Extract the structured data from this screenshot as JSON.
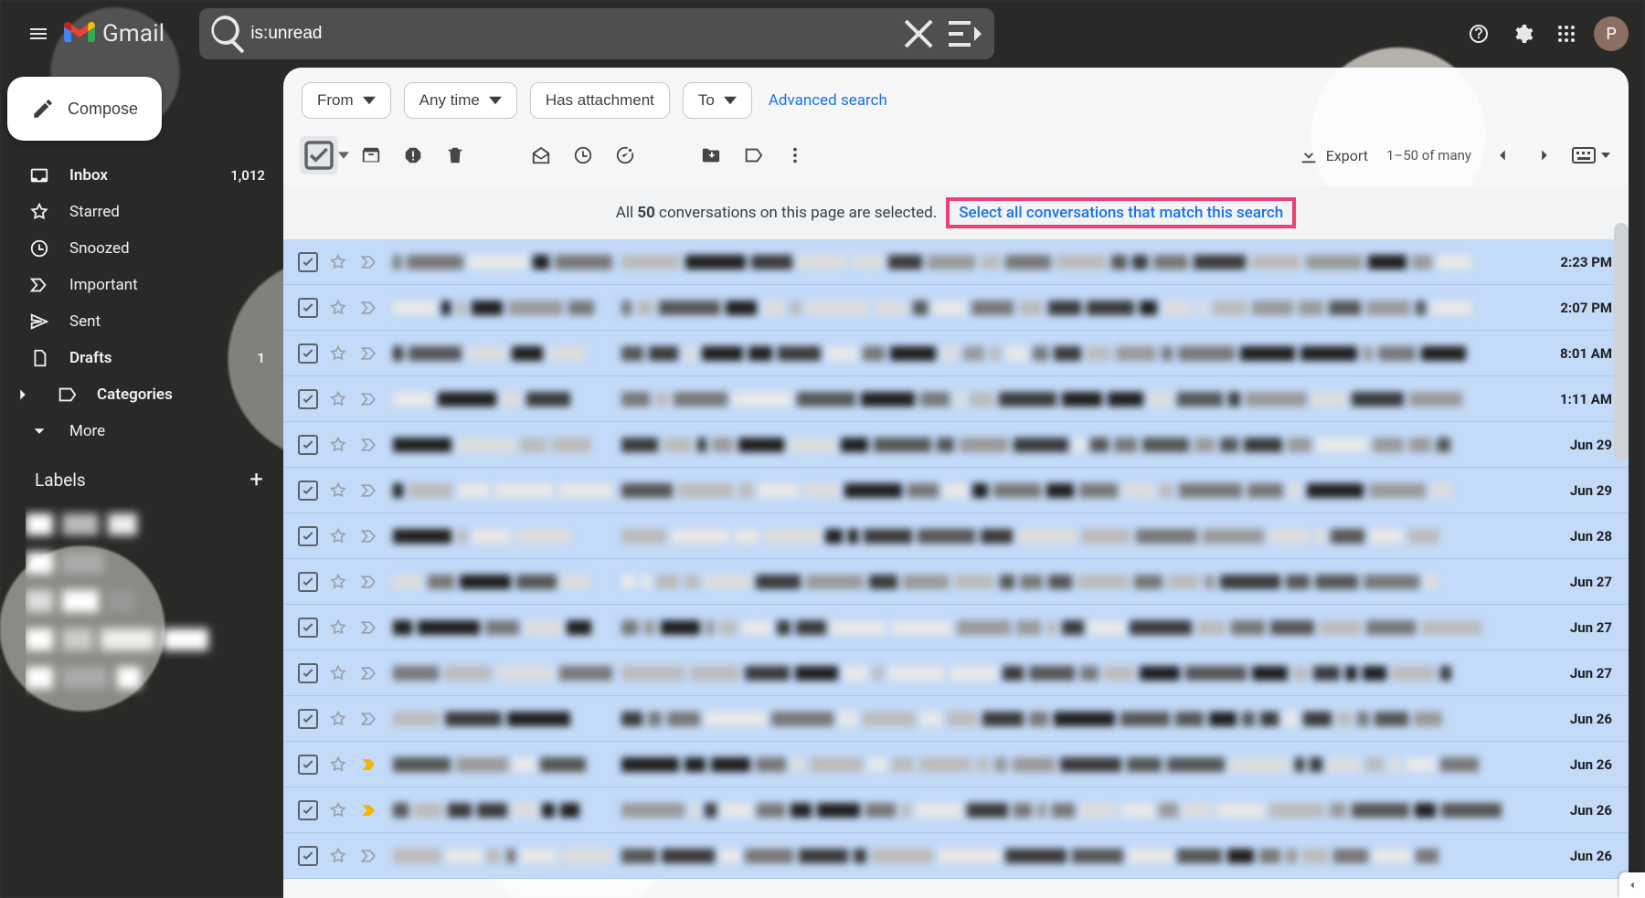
{
  "app_name": "Gmail",
  "search": {
    "value": "is:unread"
  },
  "avatar_initial": "P",
  "sidebar": {
    "compose_label": "Compose",
    "nav": [
      {
        "icon": "inbox",
        "label": "Inbox",
        "count": "1,012",
        "bold": true
      },
      {
        "icon": "star",
        "label": "Starred"
      },
      {
        "icon": "clock",
        "label": "Snoozed"
      },
      {
        "icon": "importance",
        "label": "Important"
      },
      {
        "icon": "send",
        "label": "Sent"
      },
      {
        "icon": "file",
        "label": "Drafts",
        "count": "1",
        "bold": true
      },
      {
        "icon": "category",
        "label": "Categories",
        "bold": true,
        "caret": true
      },
      {
        "icon": "chevron-down",
        "label": "More"
      }
    ],
    "labels_header": "Labels"
  },
  "filters": {
    "from": "From",
    "any_time": "Any time",
    "has_attachment": "Has attachment",
    "to": "To",
    "advanced": "Advanced search"
  },
  "toolbar": {
    "export": "Export",
    "page_info": "1–50 of many"
  },
  "selection_banner": {
    "prefix": "All ",
    "bold": "50",
    "suffix": " conversations on this page are selected.",
    "link": "Select all conversations that match this search"
  },
  "rows": [
    {
      "time": "2:23 PM",
      "imp": false
    },
    {
      "time": "2:07 PM",
      "imp": false
    },
    {
      "time": "8:01 AM",
      "imp": false
    },
    {
      "time": "1:11 AM",
      "imp": false
    },
    {
      "time": "Jun 29",
      "imp": false
    },
    {
      "time": "Jun 29",
      "imp": false
    },
    {
      "time": "Jun 28",
      "imp": false
    },
    {
      "time": "Jun 27",
      "imp": false
    },
    {
      "time": "Jun 27",
      "imp": false
    },
    {
      "time": "Jun 27",
      "imp": false
    },
    {
      "time": "Jun 26",
      "imp": false
    },
    {
      "time": "Jun 26",
      "imp": true
    },
    {
      "time": "Jun 26",
      "imp": true
    },
    {
      "time": "Jun 26",
      "imp": false
    }
  ]
}
